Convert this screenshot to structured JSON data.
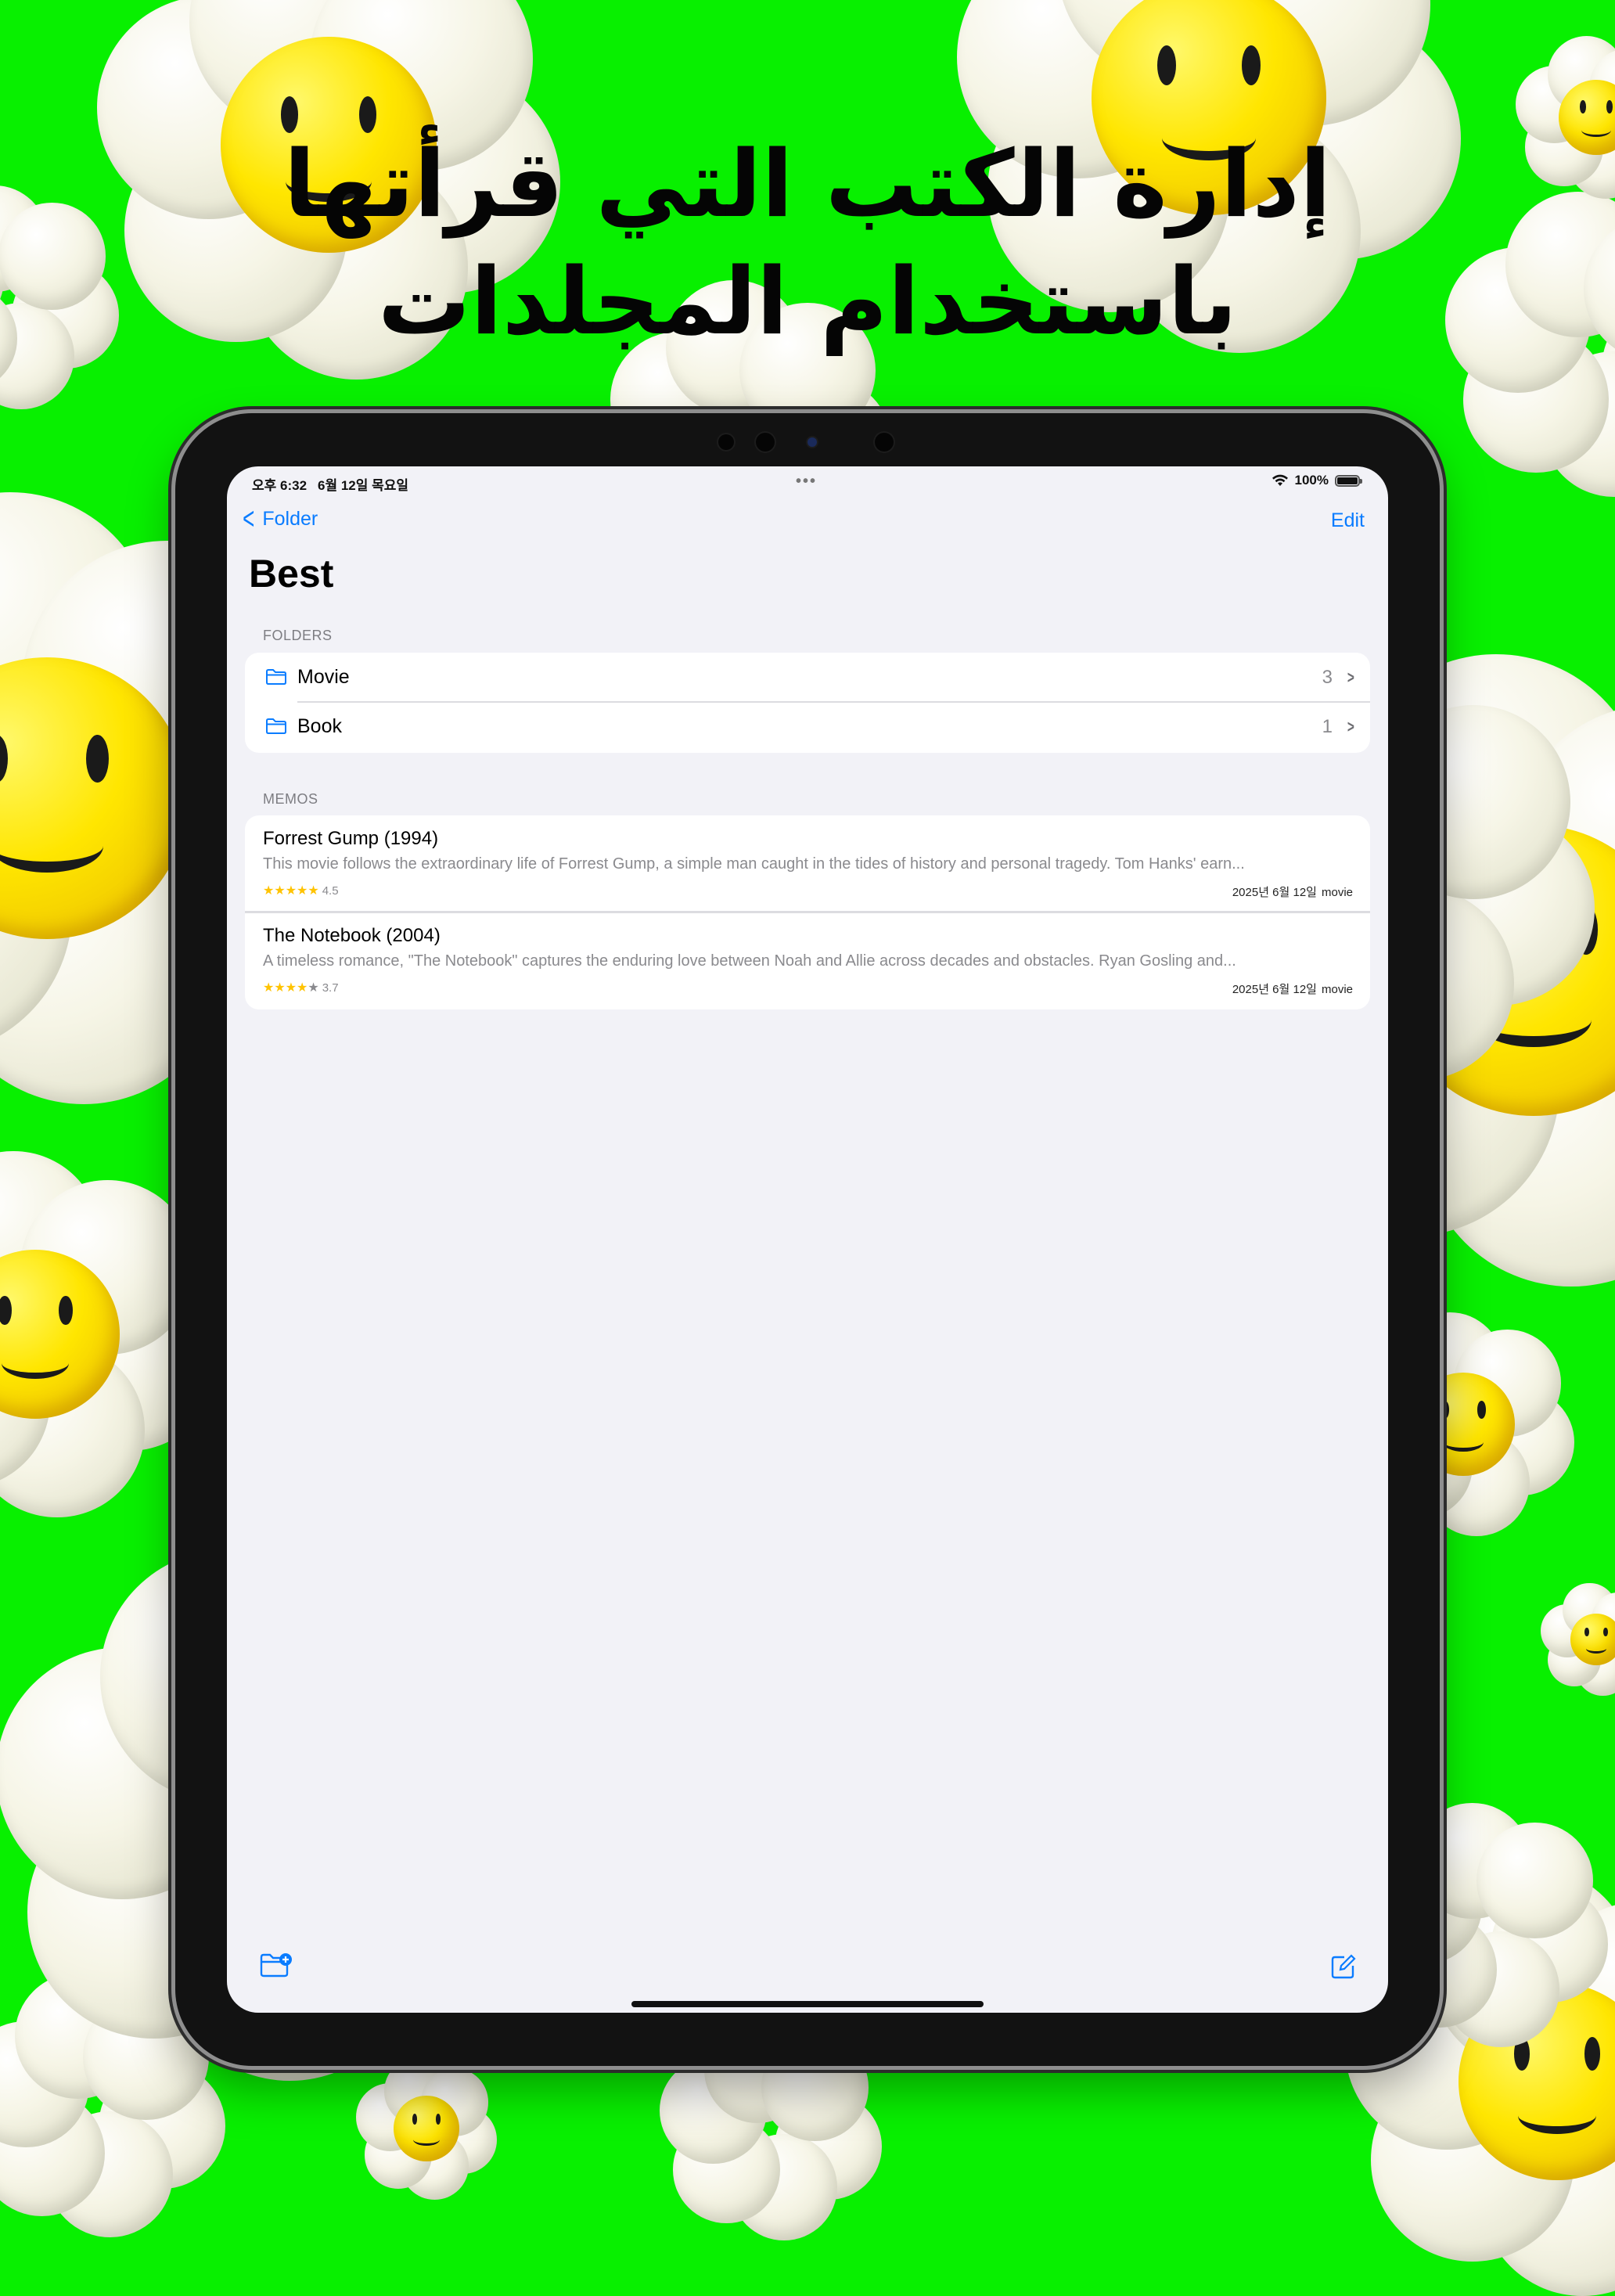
{
  "headline": {
    "line1": "إدارة الكتب التي قرأتها",
    "line2": "باستخدام المجلدات"
  },
  "status_bar": {
    "time": "오후 6:32",
    "date": "6월 12일 목요일",
    "battery": "100%",
    "icons": [
      "wifi-icon",
      "battery-icon"
    ]
  },
  "nav": {
    "back_label": "Folder",
    "edit_label": "Edit",
    "title": "Best"
  },
  "folders": {
    "header": "FOLDERS",
    "items": [
      {
        "name": "Movie",
        "count": "3",
        "icon": "folder-icon"
      },
      {
        "name": "Book",
        "count": "1",
        "icon": "folder-icon"
      }
    ]
  },
  "memos": {
    "header": "MEMOS",
    "items": [
      {
        "title": "Forrest Gump (1994)",
        "body": "This movie follows the extraordinary life of Forrest Gump, a simple man caught in the tides of history and personal tragedy. Tom Hanks' earn...",
        "stars_filled": 5,
        "rating": "4.5",
        "date": "2025년 6월 12일",
        "category": "movie"
      },
      {
        "title": "The Notebook (2004)",
        "body": "A timeless romance, \"The Notebook\" captures the enduring love between Noah and Allie across decades and obstacles. Ryan Gosling and...",
        "stars_filled": 4,
        "rating": "3.7",
        "date": "2025년 6월 12일",
        "category": "movie"
      }
    ]
  },
  "toolbar": {
    "left_icon": "new-folder-icon",
    "right_icon": "compose-icon"
  },
  "colors": {
    "background": "#08f000",
    "accent": "#0a7cff",
    "star": "#ffc300"
  }
}
